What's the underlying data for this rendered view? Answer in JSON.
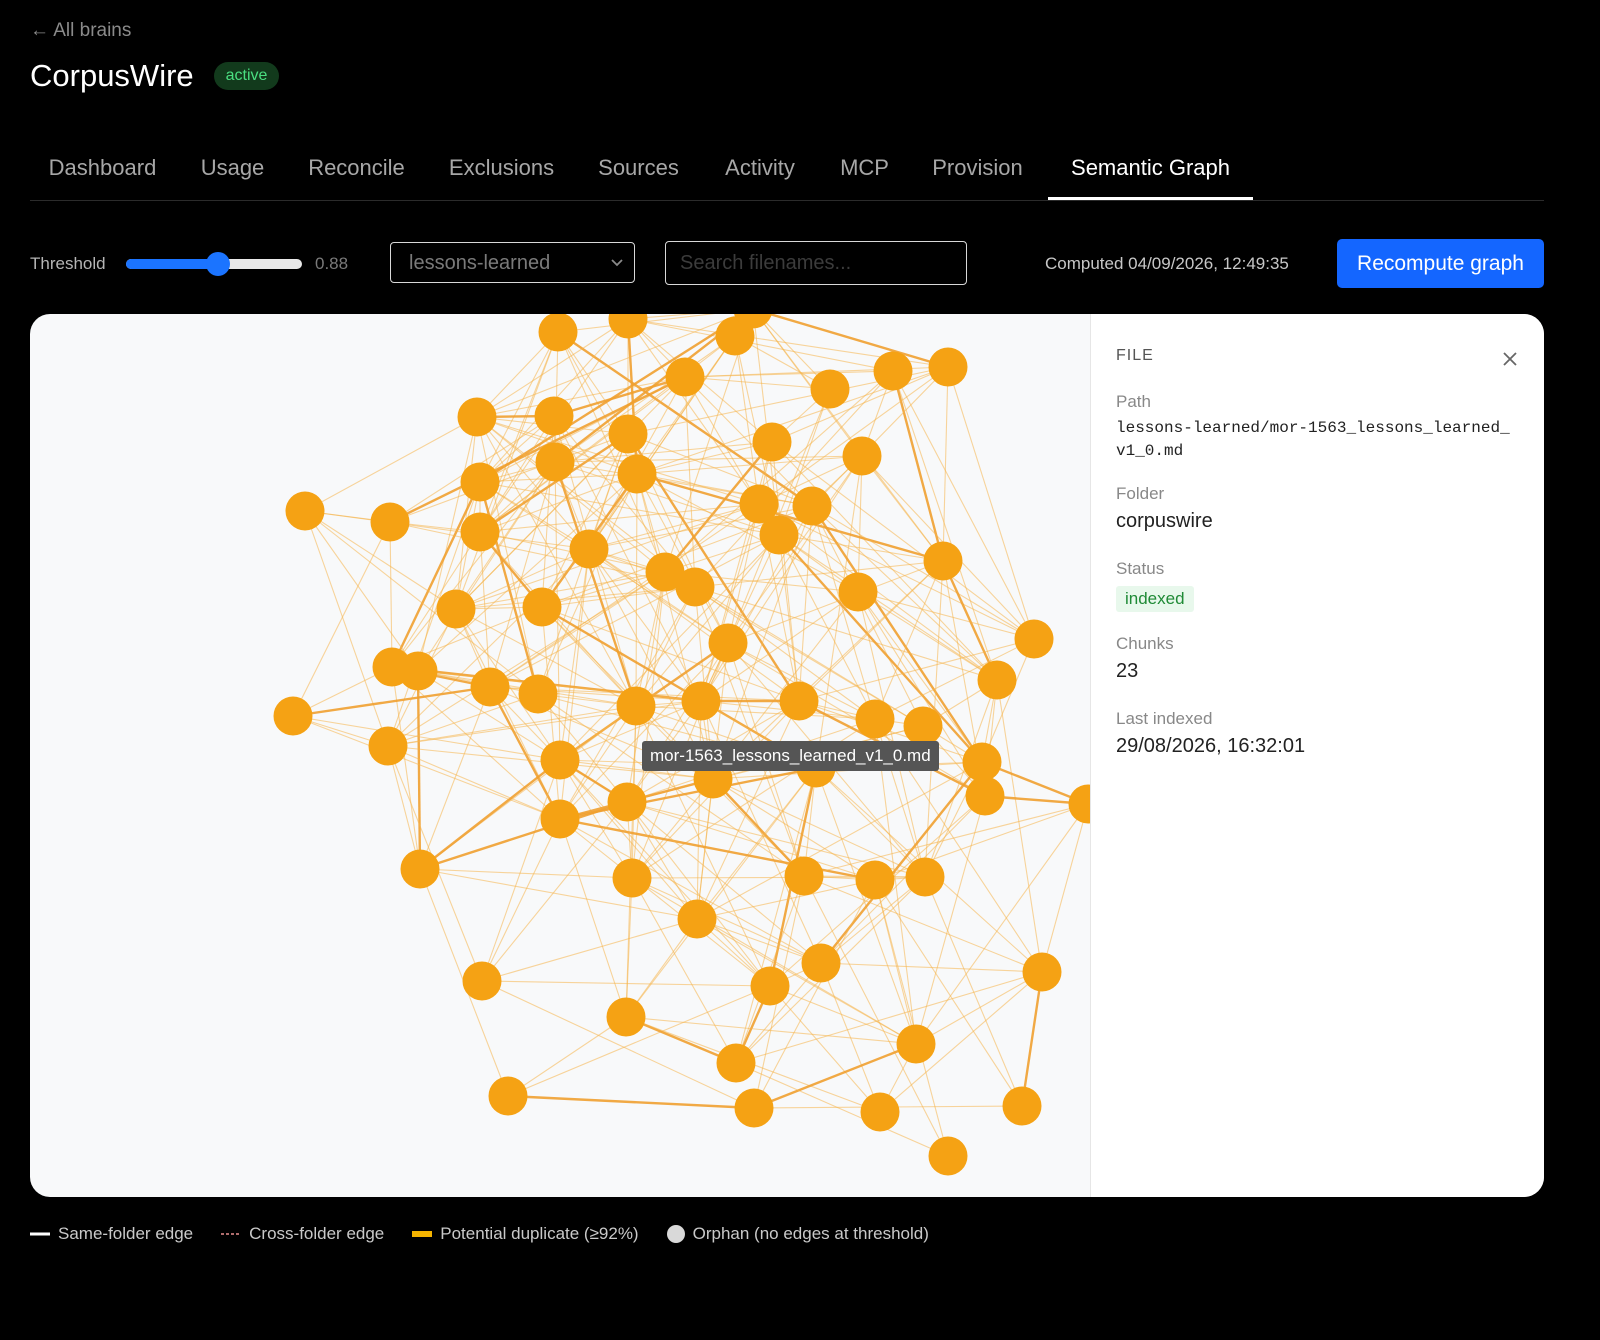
{
  "nav": {
    "back_label": "← All brains"
  },
  "brain": {
    "name": "CorpusWire",
    "status": "active"
  },
  "tabs": [
    {
      "label": "Dashboard"
    },
    {
      "label": "Usage"
    },
    {
      "label": "Reconcile"
    },
    {
      "label": "Exclusions"
    },
    {
      "label": "Sources"
    },
    {
      "label": "Activity"
    },
    {
      "label": "MCP"
    },
    {
      "label": "Provision"
    },
    {
      "label": "Semantic Graph"
    }
  ],
  "active_tab": "Semantic Graph",
  "toolbar": {
    "threshold_label": "Threshold",
    "threshold_value": "0.88",
    "threshold_fraction": 0.52,
    "folder_selected": "lessons-learned",
    "search_placeholder": "Search filenames...",
    "computed_text": "Computed 04/09/2026, 12:49:35",
    "recompute_label": "Recompute graph"
  },
  "graph": {
    "tooltip": "mor-1563_lessons_learned_v1_0.md",
    "node_color": "#f5a214",
    "edge_color": "#f5b54a"
  },
  "file_panel": {
    "header": "FILE",
    "path_label": "Path",
    "path": "lessons-learned/mor-1563_lessons_learned_v1_0.md",
    "folder_label": "Folder",
    "folder": "corpuswire",
    "status_label": "Status",
    "status": "indexed",
    "chunks_label": "Chunks",
    "chunks": "23",
    "last_indexed_label": "Last indexed",
    "last_indexed": "29/08/2026, 16:32:01"
  },
  "legend": {
    "same_folder": "Same-folder edge",
    "cross_folder": "Cross-folder edge",
    "duplicate": "Potential duplicate (≥92%)",
    "orphan": "Orphan (no edges at threshold)"
  }
}
